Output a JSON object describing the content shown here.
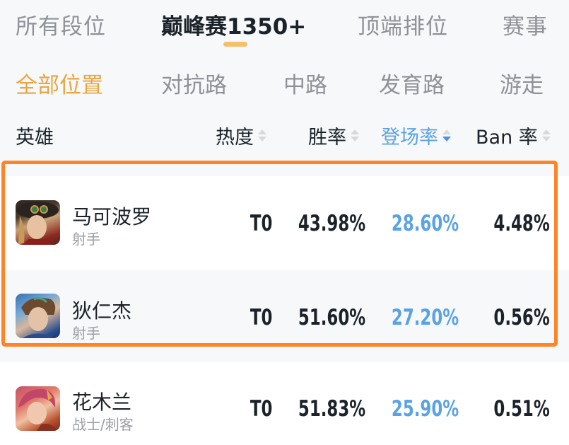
{
  "rank_tabs": [
    {
      "label": "所有段位",
      "active": false
    },
    {
      "label": "巅峰赛1350+",
      "active": true
    },
    {
      "label": "顶端排位",
      "active": false
    },
    {
      "label": "赛事",
      "active": false
    }
  ],
  "position_tabs": [
    {
      "label": "全部位置",
      "active": true
    },
    {
      "label": "对抗路",
      "active": false
    },
    {
      "label": "中路",
      "active": false
    },
    {
      "label": "发育路",
      "active": false
    },
    {
      "label": "游走",
      "active": false
    }
  ],
  "table": {
    "columns": [
      {
        "label": "英雄",
        "sortable": false
      },
      {
        "label": "热度",
        "sortable": true,
        "sort": "none"
      },
      {
        "label": "胜率",
        "sortable": true,
        "sort": "none"
      },
      {
        "label": "登场率",
        "sortable": true,
        "sort": "desc",
        "active": true
      },
      {
        "label": "Ban 率",
        "sortable": true,
        "sort": "none"
      }
    ],
    "rows": [
      {
        "name": "马可波罗",
        "role": "射手",
        "tier": "T0",
        "win_rate": "43.98%",
        "pick_rate": "28.60%",
        "ban_rate": "4.48%",
        "highlighted": true
      },
      {
        "name": "狄仁杰",
        "role": "射手",
        "tier": "T0",
        "win_rate": "51.60%",
        "pick_rate": "27.20%",
        "ban_rate": "0.56%",
        "highlighted": true
      },
      {
        "name": "花木兰",
        "role": "战士/刺客",
        "tier": "T0",
        "win_rate": "51.83%",
        "pick_rate": "25.90%",
        "ban_rate": "0.51%",
        "highlighted": false
      }
    ]
  },
  "colors": {
    "accent_orange": "#e9a540",
    "active_blue": "#5aa2e6",
    "highlight_border": "#ff8427",
    "underline": "#f5c06e"
  }
}
